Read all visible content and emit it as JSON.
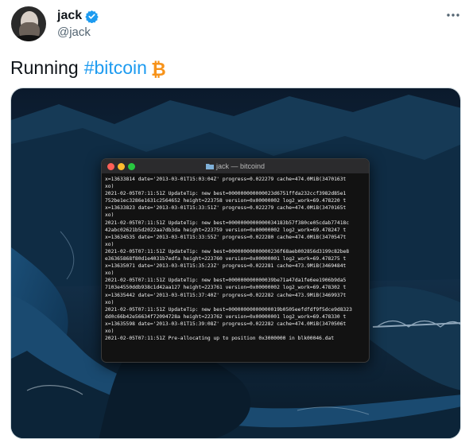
{
  "user": {
    "display_name": "jack",
    "handle": "@jack",
    "verified": true
  },
  "tweet": {
    "text": "Running",
    "hashtag": "#bitcoin",
    "emoji_icon": "bitcoin-icon"
  },
  "colors": {
    "link": "#1d9bf0",
    "verified": "#1d9bf0",
    "bitcoin": "#f7931a"
  },
  "terminal": {
    "title": "jack — bitcoind",
    "lines": [
      "x=13633814 date='2013-03-01T15:03:04Z' progress=0.022279 cache=474.0MiB(3470163t",
      "xo)",
      "2021-02-05T07:11:51Z UpdateTip: new best=000000000000023d6751ffda232ccf3982d85e1",
      "752be1ec3286e1631c2564652 height=223758 version=0x00000002 log2_work=69.478220 t",
      "x=13633823 date='2013-03-01T15:33:51Z' progress=0.022279 cache=474.0MiB(3470165t",
      "xo)",
      "2021-02-05T07:11:51Z UpdateTip: new best=0000000000000034183b57f380ce05cdab77418c",
      "42abc02621b5d2022aa7db3da height=223759 version=0x00000002 log2_work=69.478247 t",
      "x=13634535 date='2013-03-01T15:33:55Z' progress=0.022280 cache=474.0MiB(3470547t",
      "xo)",
      "2021-02-05T07:11:51Z UpdateTip: new best=00000000000000236f68aeb002856d3199c82be8",
      "e36365868f80d1e4031b7edfa height=223760 version=0x00000001 log2_work=69.478275 t",
      "x=13635071 date='2013-03-01T15:35:23Z' progress=0.022281 cache=473.9MiB(3469484t",
      "xo)",
      "2021-02-05T07:11:51Z UpdateTip: new best=000000000000039be71a47da1fe6ee1906b9da5",
      "7103e4550ddb938c1d42aa127 height=223761 version=0x00000002 log2_work=69.478302 t",
      "x=13635442 date='2013-03-01T15:37:40Z' progress=0.022282 cache=473.9MiB(3469937t",
      "xo)",
      "2021-02-05T07:11:51Z UpdateTip: new best=00000000000000019b0505eefdfdf9f5dce9d8323",
      "dd0c66b42e56634f72094728a height=223762 version=0x00000001 log2_work=69.478330 t",
      "x=13635598 date='2013-03-01T15:39:08Z' progress=0.022282 cache=474.0MiB(3470506t",
      "xo)",
      "2021-02-05T07:11:51Z Pre-allocating up to position 0x3000000 in blk00046.dat"
    ]
  }
}
